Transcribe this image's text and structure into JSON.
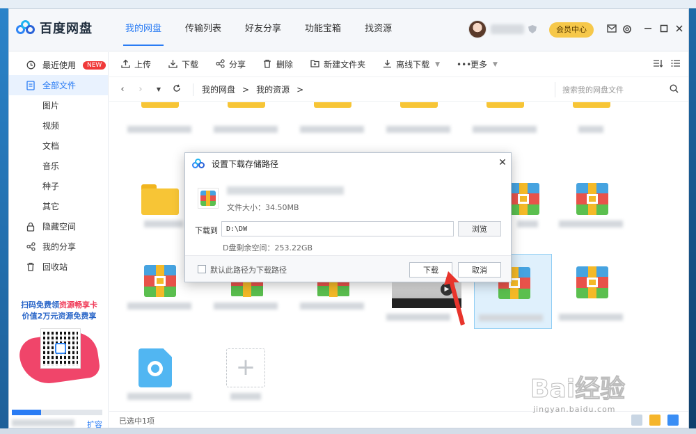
{
  "app": {
    "name": "百度网盘"
  },
  "nav": {
    "tabs": [
      "我的网盘",
      "传输列表",
      "好友分享",
      "功能宝箱",
      "找资源"
    ],
    "active": 0
  },
  "header": {
    "vip_label": "会员中心"
  },
  "sidebar": {
    "recent": "最近使用",
    "recent_badge": "NEW",
    "all_files": "全部文件",
    "sub_items": [
      "图片",
      "视频",
      "文档",
      "音乐",
      "种子",
      "其它"
    ],
    "hidden_space": "隐藏空间",
    "my_share": "我的分享",
    "recycle": "回收站",
    "promo_line1_a": "扫码免费领",
    "promo_line1_b": "资源畅享卡",
    "promo_line2": "价值2万元资源免费享",
    "storage_used_fraction": 0.32,
    "expand_link": "扩容"
  },
  "toolbar": {
    "upload": "上传",
    "download": "下载",
    "share": "分享",
    "delete": "删除",
    "new_folder": "新建文件夹",
    "offline_download": "离线下载",
    "more": "更多"
  },
  "path": {
    "crumbs": [
      "我的网盘",
      "我的资源"
    ],
    "separator": ">",
    "search_placeholder": "搜索我的网盘文件"
  },
  "status": {
    "selected_text": "已选中1项"
  },
  "dialog": {
    "title": "设置下载存储路径",
    "file_size": "文件大小：34.50MB",
    "save_to_label": "下载到",
    "path_value": "D:\\DW",
    "browse_label": "浏览",
    "free_space": "D盘剩余空间：253.22GB",
    "default_path_label": "默认此路径为下载路径",
    "download_button": "下载",
    "cancel_button": "取消"
  },
  "watermark": {
    "brand": "Bai经验",
    "url": "jingyan.baidu.com"
  },
  "icons": {
    "recent": "clock-icon",
    "all_files": "file-icon",
    "hidden": "lock-icon",
    "share": "share-icon",
    "recycle": "trash-icon",
    "search": "search-icon"
  },
  "colors": {
    "accent": "#2a7cf4",
    "vip": "#f6c84a",
    "badge": "#f03a3a",
    "annotation": "#e8342c"
  }
}
